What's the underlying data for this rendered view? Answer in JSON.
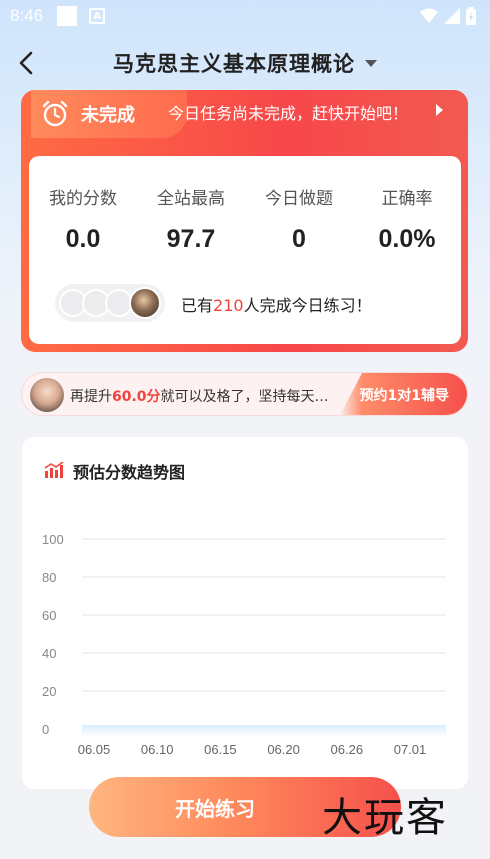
{
  "status_bar": {
    "time": "8:46",
    "notification_icon": "A"
  },
  "header": {
    "title": "马克思主义基本原理概论"
  },
  "task": {
    "status": "未完成",
    "hint": "今日任务尚未完成，赶快开始吧！",
    "stats": [
      {
        "label": "我的分数",
        "value": "0.0"
      },
      {
        "label": "全站最高",
        "value": "97.7"
      },
      {
        "label": "今日做题",
        "value": "0"
      },
      {
        "label": "正确率",
        "value": "0.0%"
      }
    ],
    "completed_prefix": "已有",
    "completed_count": "210",
    "completed_suffix": "人完成今日练习！"
  },
  "tutor": {
    "text_prefix": "再提升",
    "text_highlight": "60.0分",
    "text_suffix": "就可以及格了，坚持每天…",
    "button_label": "预约1对1辅导"
  },
  "chart_data": {
    "title": "预估分数趋势图",
    "type": "area",
    "x": [
      "06.05",
      "06.10",
      "06.15",
      "06.20",
      "06.26",
      "07.01"
    ],
    "y_ticks": [
      "100",
      "80",
      "60",
      "40",
      "20",
      "0"
    ],
    "ylim": [
      0,
      100
    ],
    "series": [
      {
        "values": [
          0,
          0,
          0,
          0,
          0,
          0
        ]
      }
    ],
    "grid": true,
    "colors": {
      "line_start": "#1a7de6",
      "line_end": "#8fd0ff"
    }
  },
  "start_button": {
    "label": "开始练习"
  },
  "watermark": {
    "text": "大玩客"
  }
}
